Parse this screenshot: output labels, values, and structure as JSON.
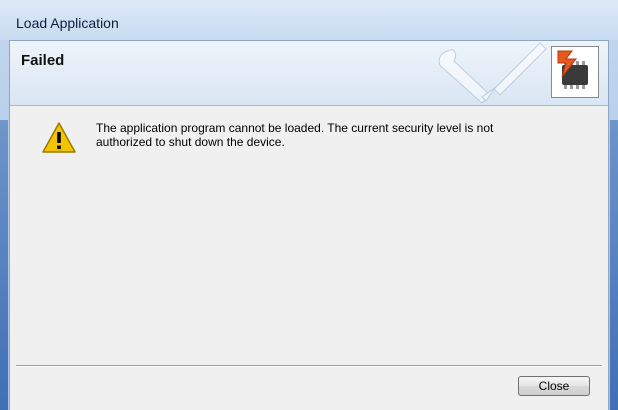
{
  "window": {
    "title": "Load Application"
  },
  "header": {
    "title": "Failed",
    "art_icon": "wrench-screwdriver-icon",
    "device_icon": "chip-error-icon"
  },
  "message": {
    "icon": "warning-icon",
    "line1": "The application program cannot be loaded.  The current security level is not",
    "line2": "authorized to shut down the device."
  },
  "buttons": {
    "close_label": "Close"
  },
  "colors": {
    "frame": "#b7cde9",
    "client": "#f0f0f0",
    "warning": "#f5c400"
  }
}
